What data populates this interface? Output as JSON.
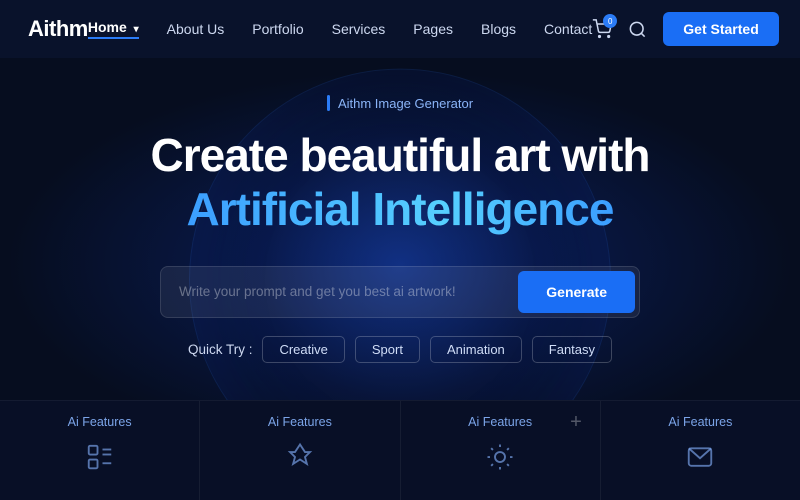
{
  "brand": {
    "logo": "Aithm"
  },
  "navbar": {
    "links": [
      {
        "label": "Home",
        "active": true,
        "has_arrow": true
      },
      {
        "label": "About Us",
        "active": false,
        "has_arrow": false
      },
      {
        "label": "Portfolio",
        "active": false,
        "has_arrow": false
      },
      {
        "label": "Services",
        "active": false,
        "has_arrow": false
      },
      {
        "label": "Pages",
        "active": false,
        "has_arrow": false
      },
      {
        "label": "Blogs",
        "active": false,
        "has_arrow": false
      },
      {
        "label": "Contact",
        "active": false,
        "has_arrow": false
      }
    ],
    "cart_count": "0",
    "cta_label": "Get Started"
  },
  "hero": {
    "badge_text": "Aithm Image Generator",
    "title_line1": "Create beautiful art with",
    "title_line2": "Artificial Intelligence",
    "search_placeholder": "Write your prompt and get you best ai artwork!",
    "generate_label": "Generate",
    "quick_try_label": "Quick Try :",
    "quick_tags": [
      "Creative",
      "Sport",
      "Animation",
      "Fantasy"
    ]
  },
  "features": [
    {
      "label": "Ai Features"
    },
    {
      "label": "Ai Features"
    },
    {
      "label": "Ai Features"
    },
    {
      "label": "Ai Features"
    }
  ],
  "colors": {
    "accent": "#1a6ef5",
    "blue_text": "#3b9eff",
    "dark_bg": "#060d1f"
  }
}
